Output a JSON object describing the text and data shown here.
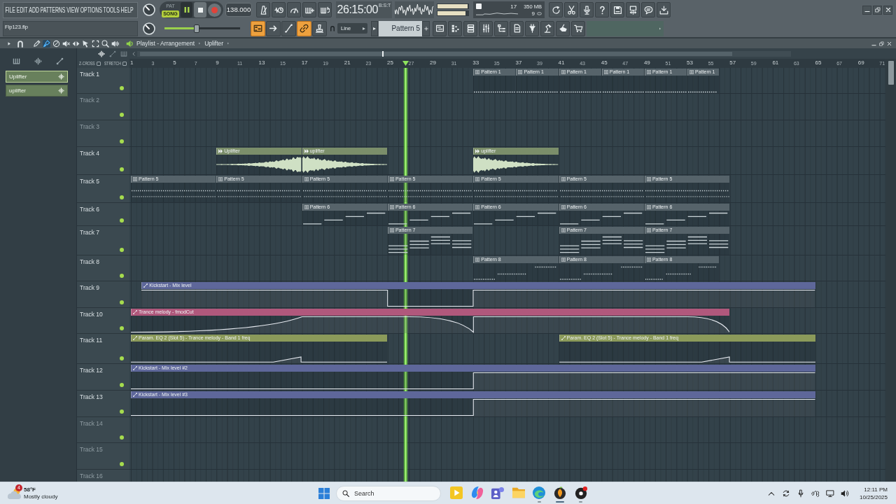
{
  "menu": [
    "FILE",
    "EDIT",
    "ADD",
    "PATTERNS",
    "VIEW",
    "OPTIONS",
    "TOOLS",
    "HELP"
  ],
  "transport": {
    "modes": [
      {
        "label": "PAT",
        "selected": false
      },
      {
        "label": "SONG",
        "selected": true
      }
    ],
    "playing": true,
    "tempo": "138.000"
  },
  "time": {
    "value": "26:15:00",
    "unit": "B:S:T"
  },
  "output_meter": [
    {
      "level": 0.97
    },
    {
      "level": 0.9
    }
  ],
  "cpu": {
    "usage": "17",
    "memory": "350 MB",
    "polyphony": "9"
  },
  "hint_bar": {
    "text": "Flp123.flp"
  },
  "master_volume": {
    "level": 0.43
  },
  "tools": [
    {
      "on": true
    },
    {
      "on": false
    },
    {
      "on": false
    },
    {
      "on": true
    },
    {
      "on": false
    }
  ],
  "snap": {
    "value": "Line"
  },
  "pattern_selector": {
    "value": "Pattern 5"
  },
  "playlist": {
    "title": "Playlist - Arrangement",
    "breadcrumb": "Uplifter",
    "tools": [
      {
        "selected": false
      },
      {
        "selected": true
      },
      {
        "selected": false
      },
      {
        "selected": false
      },
      {
        "selected": false
      },
      {
        "selected": false
      },
      {
        "selected": false
      },
      {
        "selected": false
      },
      {
        "selected": false
      }
    ],
    "options": [
      {
        "label": "Z-CROSS",
        "checked": false
      },
      {
        "label": "STRETCH",
        "checked": false
      }
    ]
  },
  "browser": [
    {
      "label": "Uplifter",
      "selected": true
    },
    {
      "label": "uplifter",
      "selected": false
    }
  ],
  "ruler": [
    "1",
    "3",
    "5",
    "7",
    "9",
    "11",
    "13",
    "15",
    "17",
    "19",
    "21",
    "23",
    "25",
    "27",
    "29",
    "31",
    "33",
    "35",
    "37",
    "39",
    "41",
    "43",
    "45",
    "47",
    "49",
    "51",
    "53",
    "55",
    "57",
    "59",
    "61",
    "63",
    "65",
    "67",
    "69",
    "71"
  ],
  "tracks": [
    {
      "name": "Track 1",
      "empty": false,
      "on": true,
      "clips": [
        {
          "kind": "pattern",
          "label": "Pattern 1",
          "color": "#56636a"
        },
        {
          "kind": "pattern",
          "label": "Pattern 1",
          "color": "#56636a"
        },
        {
          "kind": "pattern",
          "label": "Pattern 1",
          "color": "#56636a"
        },
        {
          "kind": "pattern",
          "label": "Pattern 1",
          "color": "#56636a"
        },
        {
          "kind": "pattern",
          "label": "Pattern 1",
          "color": "#56636a"
        },
        {
          "kind": "pattern",
          "label": "Pattern 1",
          "color": "#56636a"
        }
      ]
    },
    {
      "name": "Track 2",
      "empty": true,
      "on": true
    },
    {
      "name": "Track 3",
      "empty": true,
      "on": true
    },
    {
      "name": "Track 4",
      "empty": false,
      "on": true,
      "clips": [
        {
          "kind": "audio",
          "label": "Uplifter",
          "color": "#7b8e6a"
        },
        {
          "kind": "audio",
          "label": "uplifter",
          "color": "#7b8e6a"
        },
        {
          "kind": "audio",
          "label": "uplifter",
          "color": "#7b8e6a"
        }
      ]
    },
    {
      "name": "Track 5",
      "empty": false,
      "on": true,
      "clips": [
        {
          "kind": "pattern",
          "label": "Pattern 5",
          "color": "#56636a"
        },
        {
          "kind": "pattern",
          "label": "Pattern 5",
          "color": "#56636a"
        },
        {
          "kind": "pattern",
          "label": "Pattern 5",
          "color": "#56636a"
        },
        {
          "kind": "pattern",
          "label": "Pattern 5",
          "color": "#56636a"
        },
        {
          "kind": "pattern",
          "label": "Pattern 5",
          "color": "#56636a"
        },
        {
          "kind": "pattern",
          "label": "Pattern 5",
          "color": "#56636a"
        },
        {
          "kind": "pattern",
          "label": "Pattern 5",
          "color": "#56636a"
        }
      ]
    },
    {
      "name": "Track 6",
      "empty": false,
      "on": true,
      "clips": [
        {
          "kind": "pattern",
          "label": "Pattern 6",
          "color": "#56636a"
        },
        {
          "kind": "pattern",
          "label": "Pattern 6",
          "color": "#56636a"
        },
        {
          "kind": "pattern",
          "label": "Pattern 6",
          "color": "#56636a"
        },
        {
          "kind": "pattern",
          "label": "Pattern 6",
          "color": "#56636a"
        },
        {
          "kind": "pattern",
          "label": "Pattern 6",
          "color": "#56636a"
        }
      ]
    },
    {
      "name": "Track 7",
      "empty": false,
      "on": true,
      "clips": [
        {
          "kind": "pattern",
          "label": "Pattern 7",
          "color": "#56636a"
        },
        {
          "kind": "pattern",
          "label": "Pattern 7",
          "color": "#56636a"
        },
        {
          "kind": "pattern",
          "label": "Pattern 7",
          "color": "#56636a"
        }
      ]
    },
    {
      "name": "Track 8",
      "empty": false,
      "on": true,
      "clips": [
        {
          "kind": "pattern",
          "label": "Pattern 8",
          "color": "#56636a"
        },
        {
          "kind": "pattern",
          "label": "Pattern 8",
          "color": "#56636a"
        },
        {
          "kind": "pattern",
          "label": "Pattern 8",
          "color": "#56636a"
        }
      ]
    },
    {
      "name": "Track 9",
      "empty": false,
      "on": true,
      "clips": [
        {
          "kind": "automation",
          "label": "Kickstart - Mix level",
          "color": "#5e679a"
        }
      ]
    },
    {
      "name": "Track 10",
      "empty": false,
      "on": true,
      "clips": [
        {
          "kind": "automation",
          "label": "Trance melody - fmodCut",
          "color": "#b0587c"
        }
      ]
    },
    {
      "name": "Track 11",
      "empty": false,
      "on": true,
      "clips": [
        {
          "kind": "automation",
          "label": "Param. EQ 2 (Slot 5) - Trance melody - Band 1 freq",
          "color": "#8b9a5a"
        },
        {
          "kind": "automation",
          "label": "Param. EQ 2 (Slot 5) - Trance melody - Band 1 freq",
          "color": "#8b9a5a"
        }
      ]
    },
    {
      "name": "Track 12",
      "empty": false,
      "on": true,
      "clips": [
        {
          "kind": "automation",
          "label": "Kickstart - Mix level #2",
          "color": "#5e679a"
        }
      ]
    },
    {
      "name": "Track 13",
      "empty": false,
      "on": true,
      "clips": [
        {
          "kind": "automation",
          "label": "Kickstart - Mix level #3",
          "color": "#5e679a"
        }
      ]
    },
    {
      "name": "Track 14",
      "empty": true,
      "on": true
    },
    {
      "name": "Track 15",
      "empty": true,
      "on": true
    },
    {
      "name": "Track 16",
      "empty": true
    }
  ],
  "taskbar": {
    "weather": {
      "badge": "4",
      "temperature": "58°F",
      "condition": "Mostly cloudy"
    },
    "search": {
      "placeholder": "Search"
    },
    "apps": [
      {
        "running": false,
        "active": false
      },
      {
        "running": false,
        "active": false
      },
      {
        "running": false,
        "active": false
      },
      {
        "running": false,
        "active": false
      },
      {
        "running": true,
        "active": false
      },
      {
        "running": true,
        "active": true
      },
      {
        "running": true,
        "active": false
      }
    ],
    "time": "12:11 PM",
    "date": "10/25/2025"
  }
}
